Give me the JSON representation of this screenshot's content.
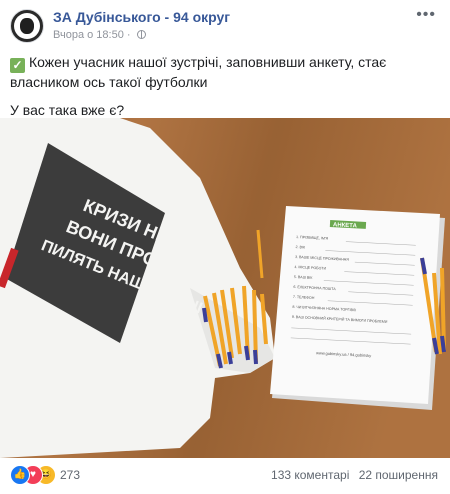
{
  "post": {
    "page_name": "ЗА Дубінського - 94 округ",
    "time": "Вчора о 18:50",
    "privacy_icon": "globe-icon",
    "more_icon": "more-options-icon",
    "check_icon": "check-mark-icon",
    "text_line1": "Кожен учасник нашої зустрічі, заповнивши анкету, стає власником ось такої футболки",
    "text_line2": "У вас така вже є?"
  },
  "photo": {
    "shirt_text": [
      "КРИЗИ НЕМАЄ,",
      "ВОНИ ПРОСТО",
      "ПИЛЯТЬ НАШІ ГРОШІ"
    ],
    "form_title": "АНКЕТА",
    "form_fields": [
      "1. ПРІЗВИЩЕ, ІМ'Я",
      "2. ВІК",
      "3. ВАШЕ МІСЦЕ ПРОЖИВАННЯ",
      "4. МІСЦЕ РОБОТИ",
      "5. ВАШ ВІК",
      "6. ЕЛЕКТРОННА ПОШТА",
      "7. ТЕЛЕФОН",
      "8. ЧИ ВІТЧИЗНЯНА НОРМА ТОРГІВЛІ",
      "9. ВАШ ОСНОВНИЙ КРИТЕРІЙ ТА ВИМОГИ ПРОБЛЕМИ"
    ],
    "form_footer": "www.gubinsky.ua / 94.gubinsky",
    "colors": {
      "table": "#a86e3c",
      "shirt": "#f4f4f2",
      "print": "#3c3c3c",
      "pen": "#f0a428",
      "pen_cap": "#3b3f98",
      "accent": "#6aa84f"
    }
  },
  "reactions": {
    "icons": [
      "like-reaction-icon",
      "love-reaction-icon",
      "haha-reaction-icon"
    ],
    "count": "273",
    "comments": "133 коментарі",
    "shares": "22 поширення"
  }
}
